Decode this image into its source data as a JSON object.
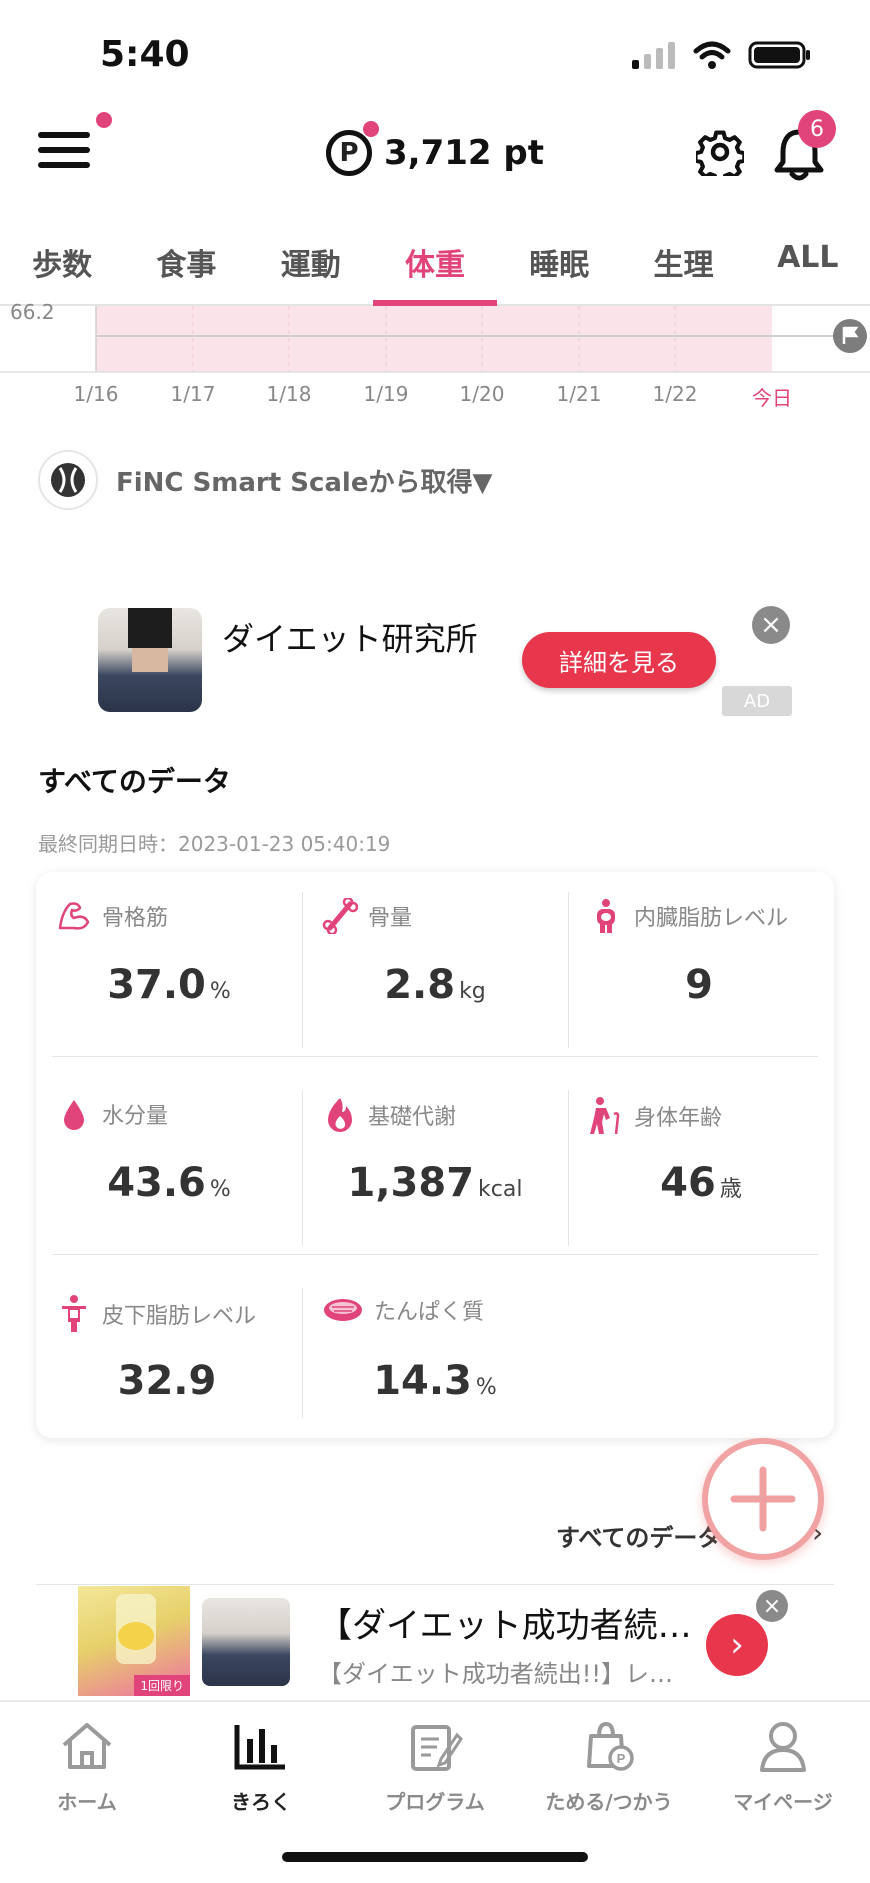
{
  "status": {
    "time": "5:40"
  },
  "header": {
    "points": "3,712 pt",
    "points_icon_letter": "P",
    "notification_count": "6"
  },
  "tabs": [
    {
      "label": "歩数"
    },
    {
      "label": "食事"
    },
    {
      "label": "運動"
    },
    {
      "label": "体重",
      "active": true
    },
    {
      "label": "睡眠"
    },
    {
      "label": "生理"
    },
    {
      "label": "ALL"
    }
  ],
  "chart_data": {
    "type": "area",
    "y_label_visible": "66.2",
    "x": [
      "1/16",
      "1/17",
      "1/18",
      "1/19",
      "1/20",
      "1/21",
      "1/22",
      "今日"
    ],
    "highlight_color": "#fbe3ea"
  },
  "source": {
    "label": "FiNC Smart Scaleから取得▼"
  },
  "ad": {
    "title": "ダイエット研究所",
    "button": "詳細を見る",
    "badge": "AD",
    "close": "×"
  },
  "all_data": {
    "title": "すべてのデータ",
    "sync": "最終同期日時：2023-01-23 05:40:19",
    "metrics": [
      {
        "name": "骨格筋",
        "value": "37.0",
        "unit": "%",
        "icon": "muscle-icon"
      },
      {
        "name": "骨量",
        "value": "2.8",
        "unit": "kg",
        "icon": "bone-icon"
      },
      {
        "name": "内臓脂肪レベル",
        "value": "9",
        "unit": "",
        "icon": "visceral-fat-icon"
      },
      {
        "name": "水分量",
        "value": "43.6",
        "unit": "%",
        "icon": "water-drop-icon"
      },
      {
        "name": "基礎代謝",
        "value": "1,387",
        "unit": "kcal",
        "icon": "flame-icon"
      },
      {
        "name": "身体年齢",
        "value": "46",
        "unit": "歳",
        "icon": "elderly-icon"
      },
      {
        "name": "皮下脂肪レベル",
        "value": "32.9",
        "unit": "",
        "icon": "body-fat-icon"
      },
      {
        "name": "たんぱく質",
        "value": "14.3",
        "unit": "%",
        "icon": "meat-icon"
      }
    ],
    "see_all": "すべてのデータ",
    "see_all_chevron": "›"
  },
  "bottom_ad": {
    "title": "【ダイエット成功者続…",
    "subtitle": "【ダイエット成功者続出!!】レ…",
    "img_tag": "1回限り",
    "go": "›",
    "close": "×"
  },
  "nav": [
    {
      "label": "ホーム",
      "icon": "home-icon"
    },
    {
      "label": "きろく",
      "icon": "chart-icon",
      "active": true
    },
    {
      "label": "プログラム",
      "icon": "program-icon"
    },
    {
      "label": "ためる/つかう",
      "icon": "points-bag-icon"
    },
    {
      "label": "マイページ",
      "icon": "person-icon"
    }
  ],
  "colors": {
    "accent": "#e0447a",
    "ad_button": "#e8374d"
  }
}
